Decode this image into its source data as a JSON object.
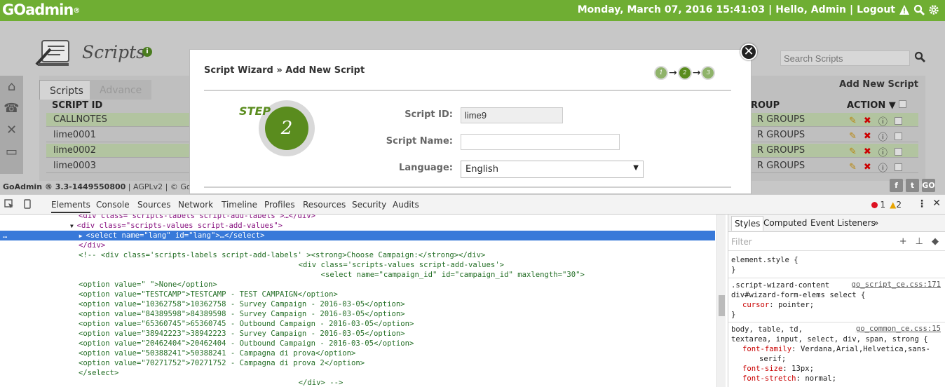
{
  "header": {
    "logo": "GOadmin",
    "logo_mark": "®",
    "datetime": "Monday, March 07, 2016 15:41:03",
    "greeting": "Hello, Admin",
    "logout": "Logout",
    "separator": "|"
  },
  "page": {
    "title": "Scripts",
    "info": "i",
    "tabs": [
      "Scripts",
      "Advance"
    ],
    "add_new": "Add New Script",
    "search_placeholder": "Search Scripts",
    "columns": {
      "script_id": "SCRIPT ID",
      "group": "ROUP",
      "action": "ACTION"
    },
    "rows": [
      {
        "id": "CALLNOTES",
        "group": "R GROUPS"
      },
      {
        "id": "lime0001",
        "group": "R GROUPS"
      },
      {
        "id": "lime0002",
        "group": "R GROUPS"
      },
      {
        "id": "lime0003",
        "group": "R GROUPS"
      }
    ],
    "footer_brand": "GoAdmin ® 3.3-1449550800",
    "footer_rest": " | AGPLv2 | © GoAu",
    "social": [
      "f",
      "t",
      "GO"
    ]
  },
  "wizard": {
    "title": "Script Wizard » Add New Script",
    "steps": [
      "1",
      "2",
      "3"
    ],
    "arrow": "→",
    "step_label": "STEP",
    "current_step": "2",
    "close": "✕",
    "fields": {
      "script_id_label": "Script ID:",
      "script_id_value": "lime9",
      "script_name_label": "Script Name:",
      "script_name_value": "",
      "language_label": "Language:",
      "language_value": "English"
    }
  },
  "devtools": {
    "tabs": [
      "Elements",
      "Console",
      "Sources",
      "Network",
      "Timeline",
      "Profiles",
      "Resources",
      "Security",
      "Audits"
    ],
    "errors": "1",
    "warnings": "2",
    "more": "⋮",
    "close": "✕",
    "code_lines": [
      {
        "indent": "    ",
        "text": "<div class=\"scripts-labels script-add-labels\">…</div>",
        "kind": "tag",
        "selected": false,
        "arrow": ""
      },
      {
        "indent": "    ",
        "text": "<div class=\"scripts-values script-add-values\">",
        "kind": "tag",
        "selected": false,
        "arrow": "▼"
      },
      {
        "indent": "      ",
        "text": "<select name=\"lang\" id=\"lang\">…</select>",
        "kind": "tag",
        "selected": true,
        "arrow": "▶"
      },
      {
        "indent": "    ",
        "text": "</div>",
        "kind": "tag",
        "selected": false,
        "arrow": ""
      },
      {
        "indent": "    ",
        "text": "<!-- <div class='scripts-labels script-add-labels' ><strong>Choose Campaign:</strong></div>",
        "kind": "cmt",
        "selected": false,
        "arrow": ""
      },
      {
        "indent": "                                                     ",
        "text": "<div class='scripts-values script-add-values'>",
        "kind": "cmt",
        "selected": false,
        "arrow": ""
      },
      {
        "indent": "                                                          ",
        "text": "<select name=\"campaign_id\" id=\"campaign_id\" maxlength=\"30\">",
        "kind": "cmt",
        "selected": false,
        "arrow": ""
      },
      {
        "indent": "    ",
        "text": "<option value=\" \">None</option>",
        "kind": "cmt",
        "selected": false,
        "arrow": ""
      },
      {
        "indent": "    ",
        "text": "<option value=\"TESTCAMP\">TESTCAMP - TEST CAMPAIGN</option>",
        "kind": "cmt",
        "selected": false,
        "arrow": ""
      },
      {
        "indent": "    ",
        "text": "<option value=\"10362758\">10362758 - Survey Campaign - 2016-03-05</option>",
        "kind": "cmt",
        "selected": false,
        "arrow": ""
      },
      {
        "indent": "    ",
        "text": "<option value=\"84389598\">84389598 - Survey Campaign - 2016-03-05</option>",
        "kind": "cmt",
        "selected": false,
        "arrow": ""
      },
      {
        "indent": "    ",
        "text": "<option value=\"65360745\">65360745 - Outbound Campaign - 2016-03-05</option>",
        "kind": "cmt",
        "selected": false,
        "arrow": ""
      },
      {
        "indent": "    ",
        "text": "<option value=\"38942223\">38942223 - Survey Campaign - 2016-03-05</option>",
        "kind": "cmt",
        "selected": false,
        "arrow": ""
      },
      {
        "indent": "    ",
        "text": "<option value=\"20462404\">20462404 - Outbound Campaign - 2016-03-05</option>",
        "kind": "cmt",
        "selected": false,
        "arrow": ""
      },
      {
        "indent": "    ",
        "text": "<option value=\"50388241\">50388241 - Campagna di prova</option>",
        "kind": "cmt",
        "selected": false,
        "arrow": ""
      },
      {
        "indent": "    ",
        "text": "<option value=\"70271752\">70271752 - Campagna di prova 2</option>",
        "kind": "cmt",
        "selected": false,
        "arrow": ""
      },
      {
        "indent": "    ",
        "text": "</select>",
        "kind": "cmt",
        "selected": false,
        "arrow": ""
      },
      {
        "indent": "                                                     ",
        "text": "</div> -->",
        "kind": "cmt",
        "selected": false,
        "arrow": ""
      }
    ],
    "styles_tabs": [
      "Styles",
      "Computed",
      "Event Listeners",
      "»"
    ],
    "filter_placeholder": "Filter",
    "rules": {
      "element_style": "element.style {",
      "close_brace": "}",
      "r1_selector": ".script-wizard-content",
      "r1_selector2": "div#wizard-form-elems select {",
      "r1_link": "go_script_ce.css:171",
      "r1_prop": "cursor",
      "r1_value": "pointer;",
      "r2_selector": "body, table, td,",
      "r2_selector2": "textarea, input, select, div, span, strong {",
      "r2_link": "go_common_ce.css:15",
      "r2_p1": "font-family",
      "r2_v1": "Verdana,Arial,Helvetica,sans-",
      "r2_v1b": "serif;",
      "r2_p2": "font-size",
      "r2_v2": "13px;",
      "r2_p3": "font-stretch",
      "r2_v3": "normal;"
    }
  }
}
